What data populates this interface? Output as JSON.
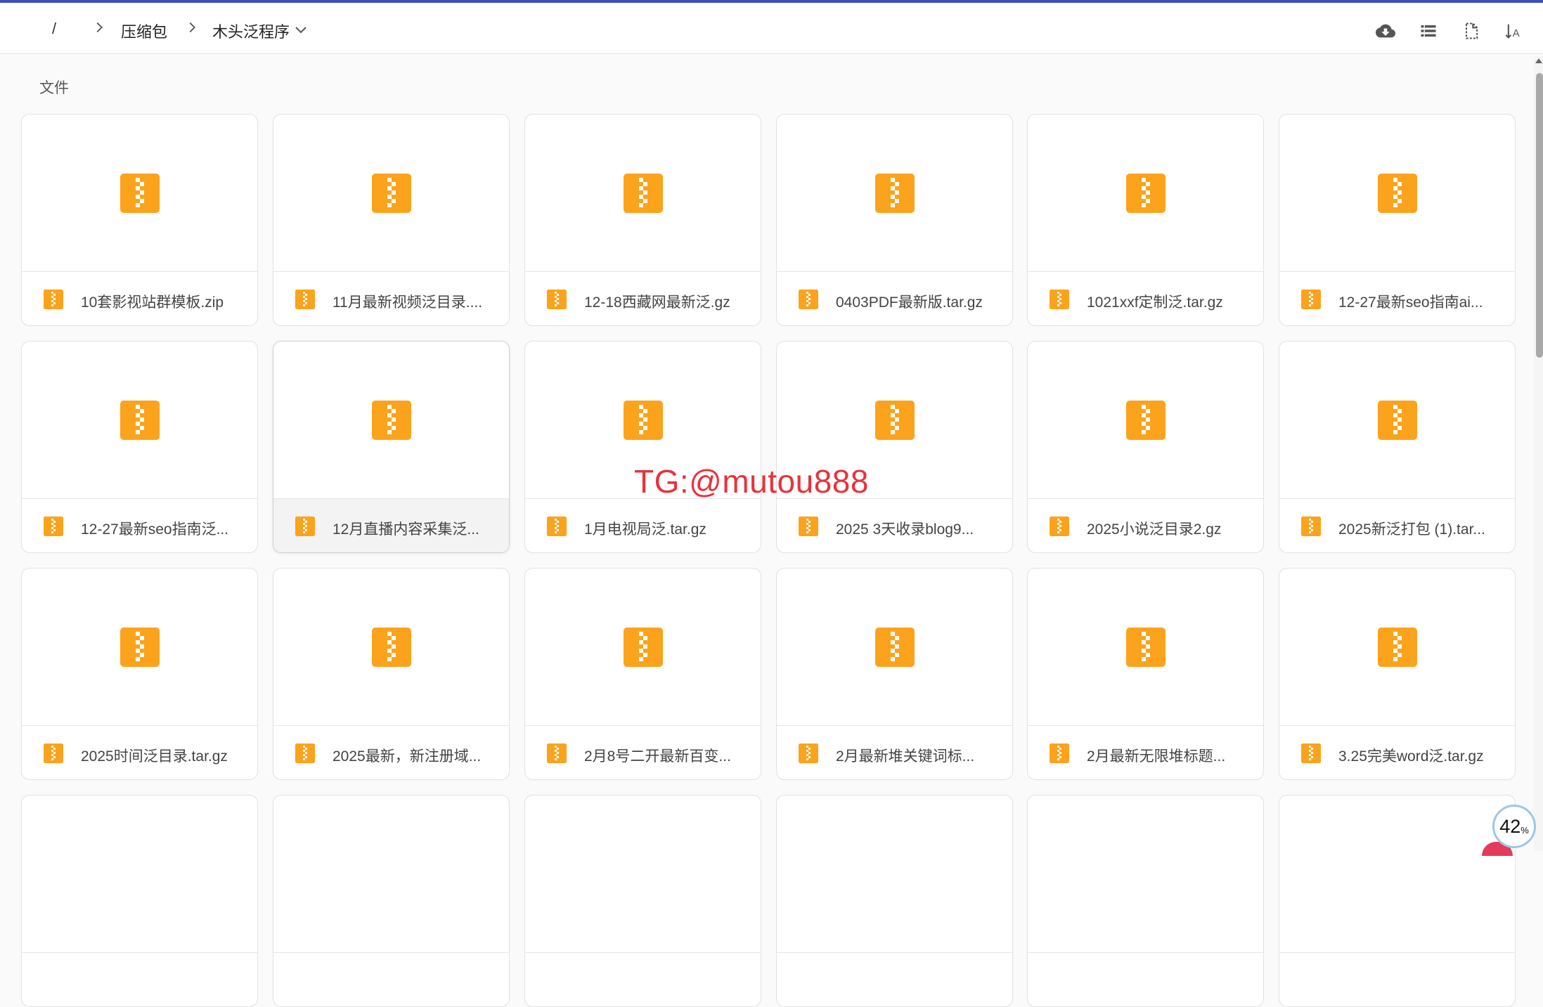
{
  "colors": {
    "accent_top": "#3f4eb8",
    "zip_orange": "#fba31c",
    "watermark": "#e8323c"
  },
  "breadcrumb": {
    "root": "/",
    "items": [
      "压缩包",
      "木头泛程序"
    ]
  },
  "toolbar": {
    "icons": [
      "cloud-download-icon",
      "list-view-icon",
      "select-file-icon",
      "sort-icon"
    ]
  },
  "section": {
    "label": "文件"
  },
  "files": [
    "10套影视站群模板.zip",
    "11月最新视频泛目录....",
    "12-18西藏网最新泛.gz",
    "0403PDF最新版.tar.gz",
    "1021xxf定制泛.tar.gz",
    "12-27最新seo指南ai...",
    "12-27最新seo指南泛...",
    "12月直播内容采集泛...",
    "1月电视局泛.tar.gz",
    "2025 3天收录blog9...",
    "2025小说泛目录2.gz",
    "2025新泛打包 (1).tar...",
    "2025时间泛目录.tar.gz",
    "2025最新，新注册域...",
    "2月8号二开最新百变...",
    "2月最新堆关键词标...",
    "2月最新无限堆标题...",
    "3.25完美word泛.tar.gz",
    "",
    "",
    "",
    "",
    "",
    ""
  ],
  "watermark": "TG:@mutou888",
  "badge": {
    "value": "42",
    "unit": "%"
  }
}
